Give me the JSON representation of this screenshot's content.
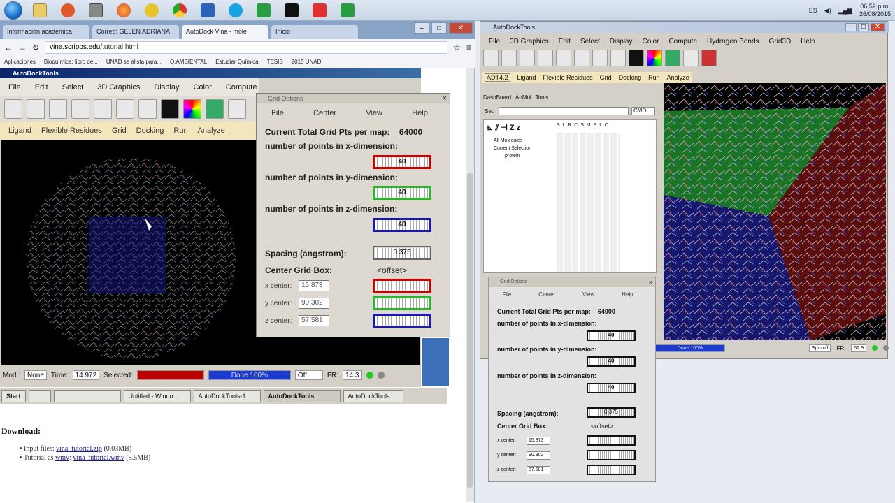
{
  "taskbar": {
    "clock_time": "06:52 p.m.",
    "clock_date": "26/08/2015"
  },
  "browser": {
    "tabs": [
      "Información académica",
      "Correo: GELEN ADRIANA",
      "AutoDock Vina - mole",
      "Inicio"
    ],
    "url_host": "vina.scripps.edu",
    "url_path": "/tutorial.html",
    "bookmarks": [
      "Aplicaciones",
      "Bioquímica: libro de...",
      "UNAD se alista para...",
      "Q.AMBIENTAL",
      "Estudiar Química",
      "TESIS",
      "2015 UNAD"
    ]
  },
  "adt_left": {
    "title": "AutoDockTools",
    "menu": [
      "File",
      "Edit",
      "Select",
      "3D Graphics",
      "Display",
      "Color",
      "Compute"
    ],
    "tabs": [
      "Ligand",
      "Flexible Residues",
      "Grid",
      "Docking",
      "Run",
      "Analyze"
    ],
    "status": {
      "mod_label": "Mod.:",
      "mod_value": "None",
      "time_label": "Time:",
      "time_value": "14.972",
      "selected_label": "Selected:",
      "progress_label": "Done 100%",
      "spin_value": "Off",
      "fr_label": "FR:",
      "fr_value": "14.3"
    }
  },
  "xp_taskbar": {
    "start": "Start",
    "items": [
      "Untitled - Windo...",
      "AutoDockTools-1....",
      "AutoDockTools",
      "AutoDockTools"
    ]
  },
  "grid_big": {
    "title": "Grid Options",
    "menu": [
      "File",
      "Center",
      "View",
      "Help"
    ],
    "total_label": "Current Total Grid Pts per map:",
    "total_value": "64000",
    "x_dim_label": "number of points in x-dimension:",
    "y_dim_label": "number of points in y-dimension:",
    "z_dim_label": "number of points in z-dimension:",
    "x_points": "40",
    "y_points": "40",
    "z_points": "40",
    "spacing_label": "Spacing (angstrom):",
    "spacing_value": "0.375",
    "center_label": "Center Grid Box:",
    "offset_label": "<offset>",
    "x_center_label": "x center:",
    "y_center_label": "y center:",
    "z_center_label": "z center:",
    "x_center": "15.873",
    "y_center": "90.302",
    "z_center": "57.581"
  },
  "page": {
    "download_heading": "Download:",
    "input_files_label": "Input files:",
    "input_files_link": "vina_tutorial.zip",
    "input_files_size": "(0.03MB)",
    "tutorial_label": "Tutorial as",
    "tutorial_link1": "wmv",
    "tutorial_link2": "vina_tutorial.wmv",
    "tutorial_size": "(5.5MB)"
  },
  "adt_right": {
    "title": "AutoDockTools",
    "menu": [
      "File",
      "3D Graphics",
      "Edit",
      "Select",
      "Display",
      "Color",
      "Compute",
      "Hydrogen Bonds",
      "Grid3D",
      "Help"
    ],
    "tabs": [
      "ADT4.2",
      "Ligand",
      "Flexible Residues",
      "Grid",
      "Docking",
      "Run",
      "Analyze"
    ],
    "dash_tabs": [
      "DashBoard",
      "AnMol",
      "Tools"
    ],
    "set_label": "Set:",
    "cmd_label": "CMD",
    "tree": [
      "All Molecules",
      "Current Selection",
      "protein"
    ],
    "col_headers": "S L R C S M S L C",
    "status": {
      "progress_label": "Done 100%",
      "spin_value": "Spin off",
      "fr_label": "FR:",
      "fr_value": "52.9"
    }
  },
  "grid_small": {
    "title": "Grid Options",
    "menu": [
      "File",
      "Center",
      "View",
      "Help"
    ],
    "total_label": "Current Total Grid Pts per map:",
    "total_value": "64000",
    "x_dim_label": "number of points in x-dimension:",
    "y_dim_label": "number of points in y-dimension:",
    "z_dim_label": "number of points in z-dimension:",
    "x_points": "40",
    "y_points": "40",
    "z_points": "40",
    "spacing_label": "Spacing (angstrom):",
    "spacing_value": "0.375",
    "center_label": "Center Grid Box:",
    "offset_label": "<offset>",
    "x_center_label": "x center:",
    "y_center_label": "y center:",
    "z_center_label": "z center:",
    "x_center": "15.873",
    "y_center": "90.302",
    "z_center": "57.581"
  },
  "colors": {
    "red": "#cc0000",
    "green": "#2cb62c",
    "blue": "#1a1ab0"
  },
  "icons": [
    "start-orb-icon",
    "file-explorer-icon",
    "office-icon",
    "firefox-icon",
    "chrome-icon",
    "skype-icon",
    "chemsketch-icon",
    "terminal-icon"
  ]
}
